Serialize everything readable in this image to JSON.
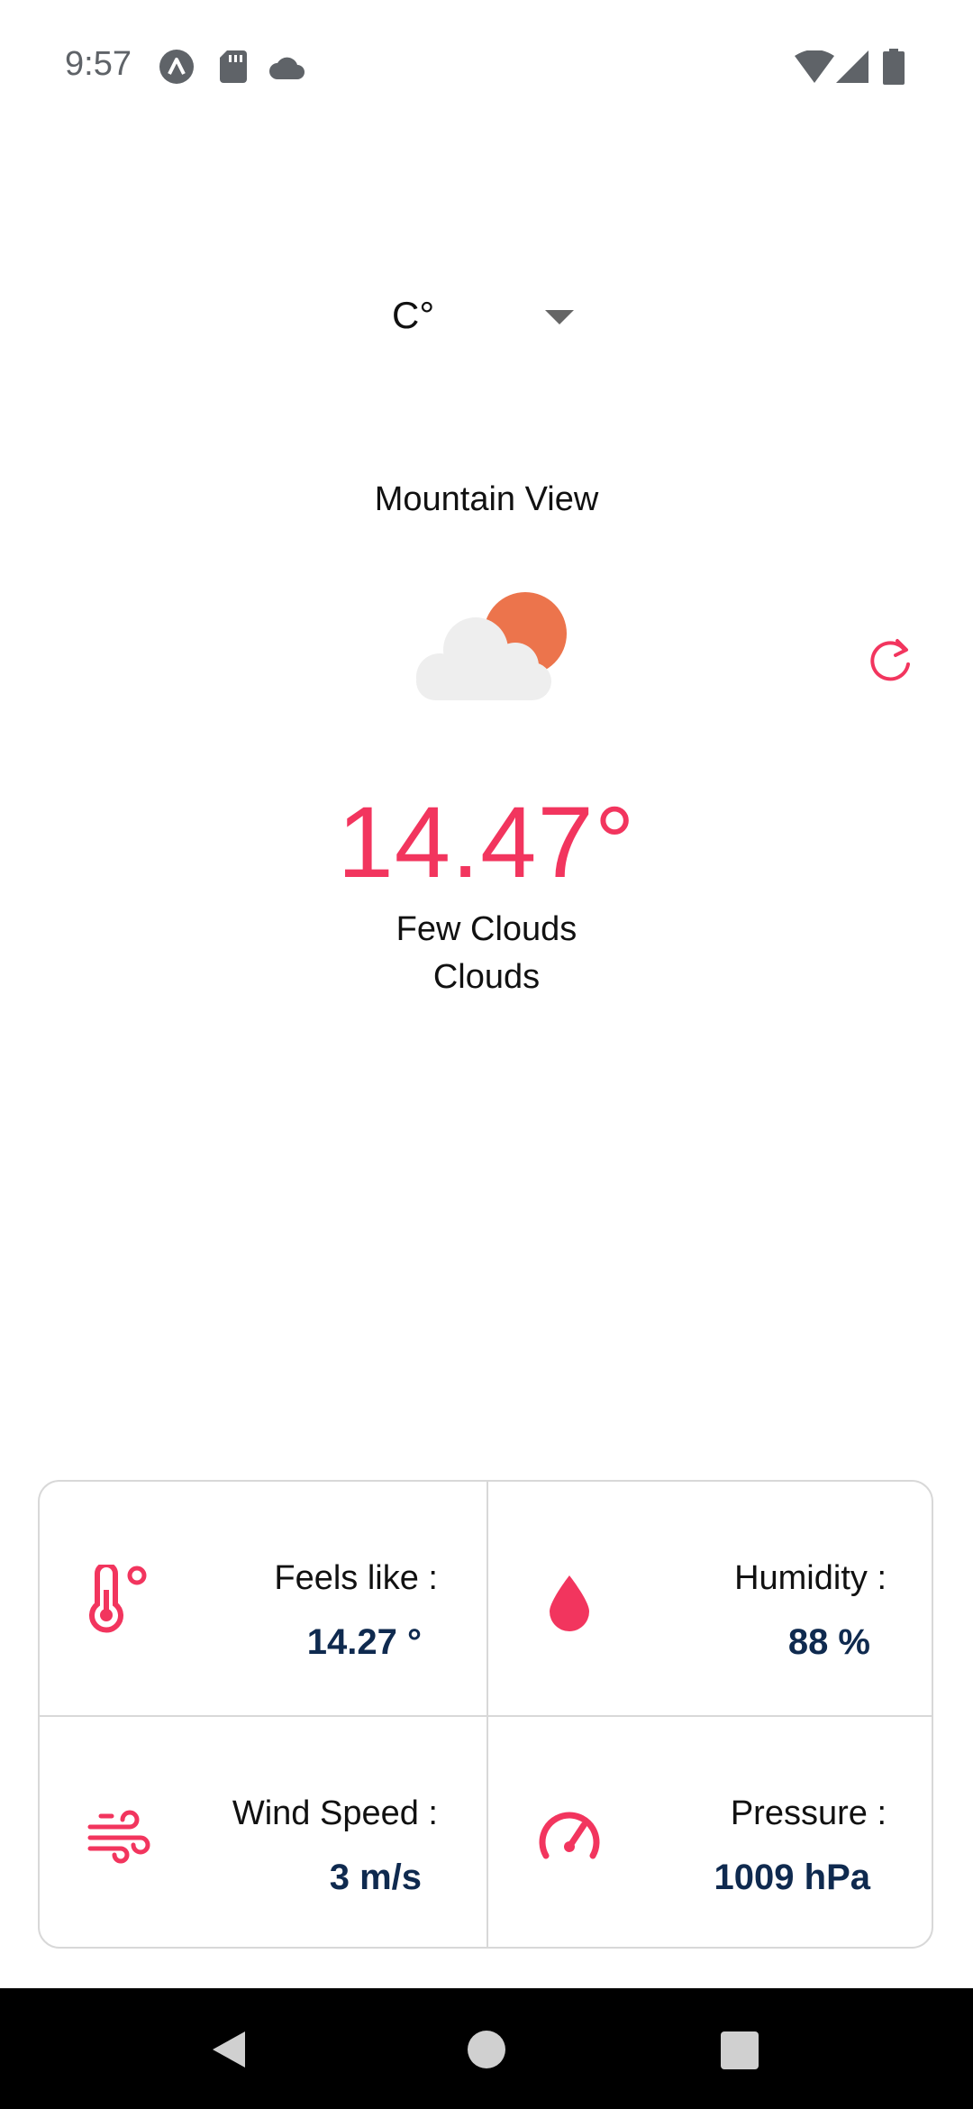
{
  "status_bar": {
    "time": "9:57",
    "left_icons": [
      "expo-icon",
      "sd-card-icon",
      "cloud-icon"
    ],
    "right_icons": [
      "wifi-icon",
      "signal-icon",
      "battery-icon"
    ]
  },
  "unit_selector": {
    "value": "C°"
  },
  "location": {
    "city": "Mountain View"
  },
  "current": {
    "temperature": "14.47°",
    "description": "Few Clouds",
    "main": "Clouds",
    "icon": "few-clouds-icon"
  },
  "details": {
    "feels_like": {
      "label": "Feels like :",
      "value": "14.27 °",
      "icon": "thermometer-icon"
    },
    "humidity": {
      "label": "Humidity :",
      "value": "88 %",
      "icon": "water-drop-icon"
    },
    "wind": {
      "label": "Wind Speed :",
      "value": "3 m/s",
      "icon": "wind-icon"
    },
    "pressure": {
      "label": "Pressure :",
      "value": "1009 hPa",
      "icon": "gauge-icon"
    }
  },
  "colors": {
    "accent": "#f2355e",
    "value_text": "#0f2a4f",
    "sun": "#ec744c",
    "cloud": "#eeeeee"
  }
}
